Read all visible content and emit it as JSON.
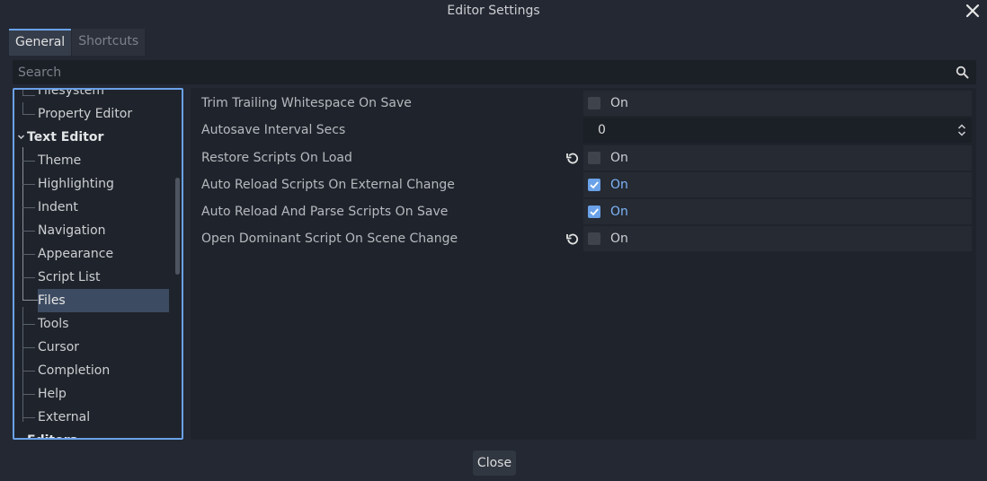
{
  "window": {
    "title": "Editor Settings"
  },
  "tabs": [
    {
      "label": "General",
      "active": true
    },
    {
      "label": "Shortcuts",
      "active": false
    }
  ],
  "search": {
    "placeholder": "Search"
  },
  "tree": {
    "items": [
      {
        "label": "Filesystem",
        "level": 1
      },
      {
        "label": "Property Editor",
        "level": 1
      },
      {
        "label": "Text Editor",
        "level": 0,
        "expanded": true
      },
      {
        "label": "Theme",
        "level": 1
      },
      {
        "label": "Highlighting",
        "level": 1
      },
      {
        "label": "Indent",
        "level": 1
      },
      {
        "label": "Navigation",
        "level": 1
      },
      {
        "label": "Appearance",
        "level": 1
      },
      {
        "label": "Script List",
        "level": 1
      },
      {
        "label": "Files",
        "level": 1,
        "selected": true
      },
      {
        "label": "Tools",
        "level": 1
      },
      {
        "label": "Cursor",
        "level": 1
      },
      {
        "label": "Completion",
        "level": 1
      },
      {
        "label": "Help",
        "level": 1
      },
      {
        "label": "External",
        "level": 1
      },
      {
        "label": "Editors",
        "level": 0
      }
    ]
  },
  "settings": [
    {
      "label": "Trim Trailing Whitespace On Save",
      "type": "bool",
      "checked": false,
      "value_text": "On",
      "revert": false
    },
    {
      "label": "Autosave Interval Secs",
      "type": "int",
      "value": "0",
      "revert": false
    },
    {
      "label": "Restore Scripts On Load",
      "type": "bool",
      "checked": false,
      "value_text": "On",
      "revert": true
    },
    {
      "label": "Auto Reload Scripts On External Change",
      "type": "bool",
      "checked": true,
      "value_text": "On",
      "revert": false
    },
    {
      "label": "Auto Reload And Parse Scripts On Save",
      "type": "bool",
      "checked": true,
      "value_text": "On",
      "revert": false
    },
    {
      "label": "Open Dominant Script On Scene Change",
      "type": "bool",
      "checked": false,
      "value_text": "On",
      "revert": true
    }
  ],
  "footer": {
    "close_label": "Close"
  },
  "colors": {
    "accent": "#6aa1e8",
    "background": "#232833",
    "panel": "#1f242c"
  }
}
